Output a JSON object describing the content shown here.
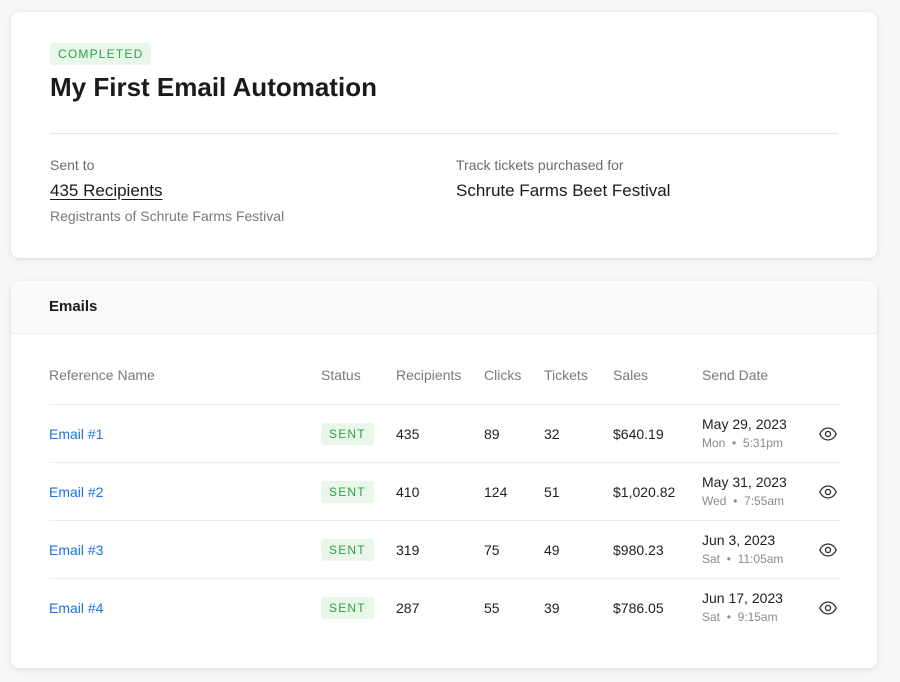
{
  "automation": {
    "status": "COMPLETED",
    "title": "My First Email Automation",
    "sent_to_label": "Sent to",
    "recipients_link": "435 Recipients",
    "recipients_desc": "Registrants of Schrute Farms Festival",
    "track_label": "Track tickets purchased for",
    "track_event": "Schrute Farms Beet Festival"
  },
  "emails": {
    "section_title": "Emails",
    "columns": {
      "name": "Reference Name",
      "status": "Status",
      "recipients": "Recipients",
      "clicks": "Clicks",
      "tickets": "Tickets",
      "sales": "Sales",
      "send_date": "Send Date"
    },
    "rows": [
      {
        "name": "Email #1",
        "status": "SENT",
        "recipients": "435",
        "clicks": "89",
        "tickets": "32",
        "sales": "$640.19",
        "date": "May 29, 2023",
        "day": "Mon",
        "time": "5:31pm"
      },
      {
        "name": "Email #2",
        "status": "SENT",
        "recipients": "410",
        "clicks": "124",
        "tickets": "51",
        "sales": "$1,020.82",
        "date": "May 31, 2023",
        "day": "Wed",
        "time": "7:55am"
      },
      {
        "name": "Email #3",
        "status": "SENT",
        "recipients": "319",
        "clicks": "75",
        "tickets": "49",
        "sales": "$980.23",
        "date": "Jun 3, 2023",
        "day": "Sat",
        "time": "11:05am"
      },
      {
        "name": "Email #4",
        "status": "SENT",
        "recipients": "287",
        "clicks": "55",
        "tickets": "39",
        "sales": "$786.05",
        "date": "Jun 17, 2023",
        "day": "Sat",
        "time": "9:15am"
      }
    ],
    "separator": "•",
    "view_icon": "eye-icon"
  },
  "colors": {
    "accent_link": "#1a73e8",
    "success_bg": "#e8f7ea",
    "success_text": "#2f9e44"
  }
}
